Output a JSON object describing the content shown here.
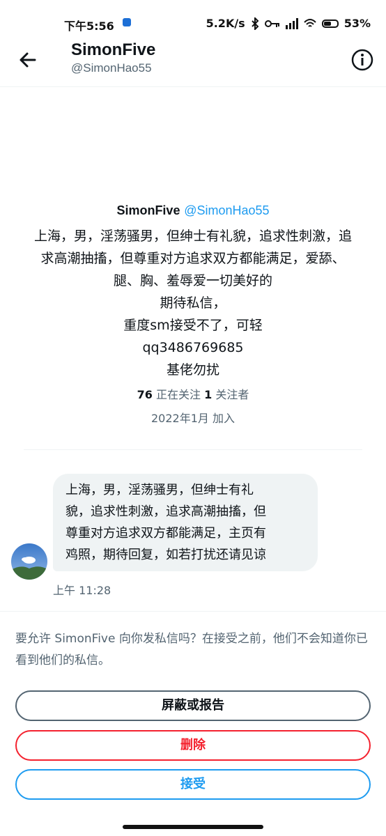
{
  "status_bar": {
    "time": "下午5:56",
    "network_speed": "5.2K/s",
    "battery": "53%"
  },
  "header": {
    "title": "SimonFive",
    "handle": "@SimonHao55",
    "back_icon": "arrow-left-icon",
    "info_icon": "info-circle-icon"
  },
  "profile": {
    "name": "SimonFive",
    "handle": "@SimonHao55",
    "bio_lines": [
      "上海，男，淫荡骚男，但绅士有礼貌，追求性刺激，追",
      "求高潮抽搐，但尊重对方追求双方都能满足，爱舔、",
      "腿、胸、羞辱爱一切美好的",
      "期待私信，",
      "重度sm接受不了，可轻",
      "qq3486769685",
      "基佬勿扰"
    ],
    "following_count": "76",
    "following_label": "正在关注",
    "followers_count": "1",
    "followers_label": "关注者",
    "joined": "2022年1月 加入"
  },
  "message": {
    "lines": [
      "上海，男，淫荡骚男，但绅士有礼",
      "貌，追求性刺激，追求高潮抽搐，但",
      "尊重对方追求双方都能满足，主页有",
      "鸡照，期待回复，如若打扰还请见谅"
    ],
    "time": "上午 11:28"
  },
  "request": {
    "prompt": "要允许 SimonFive 向你发私信吗？在接受之前，他们不会知道你已看到他们的私信。",
    "block_label": "屏蔽或报告",
    "delete_label": "删除",
    "accept_label": "接受"
  },
  "colors": {
    "accent": "#1d9bf0",
    "danger": "#f4212e",
    "secondary_text": "#536471",
    "bubble_bg": "#eff3f4"
  }
}
